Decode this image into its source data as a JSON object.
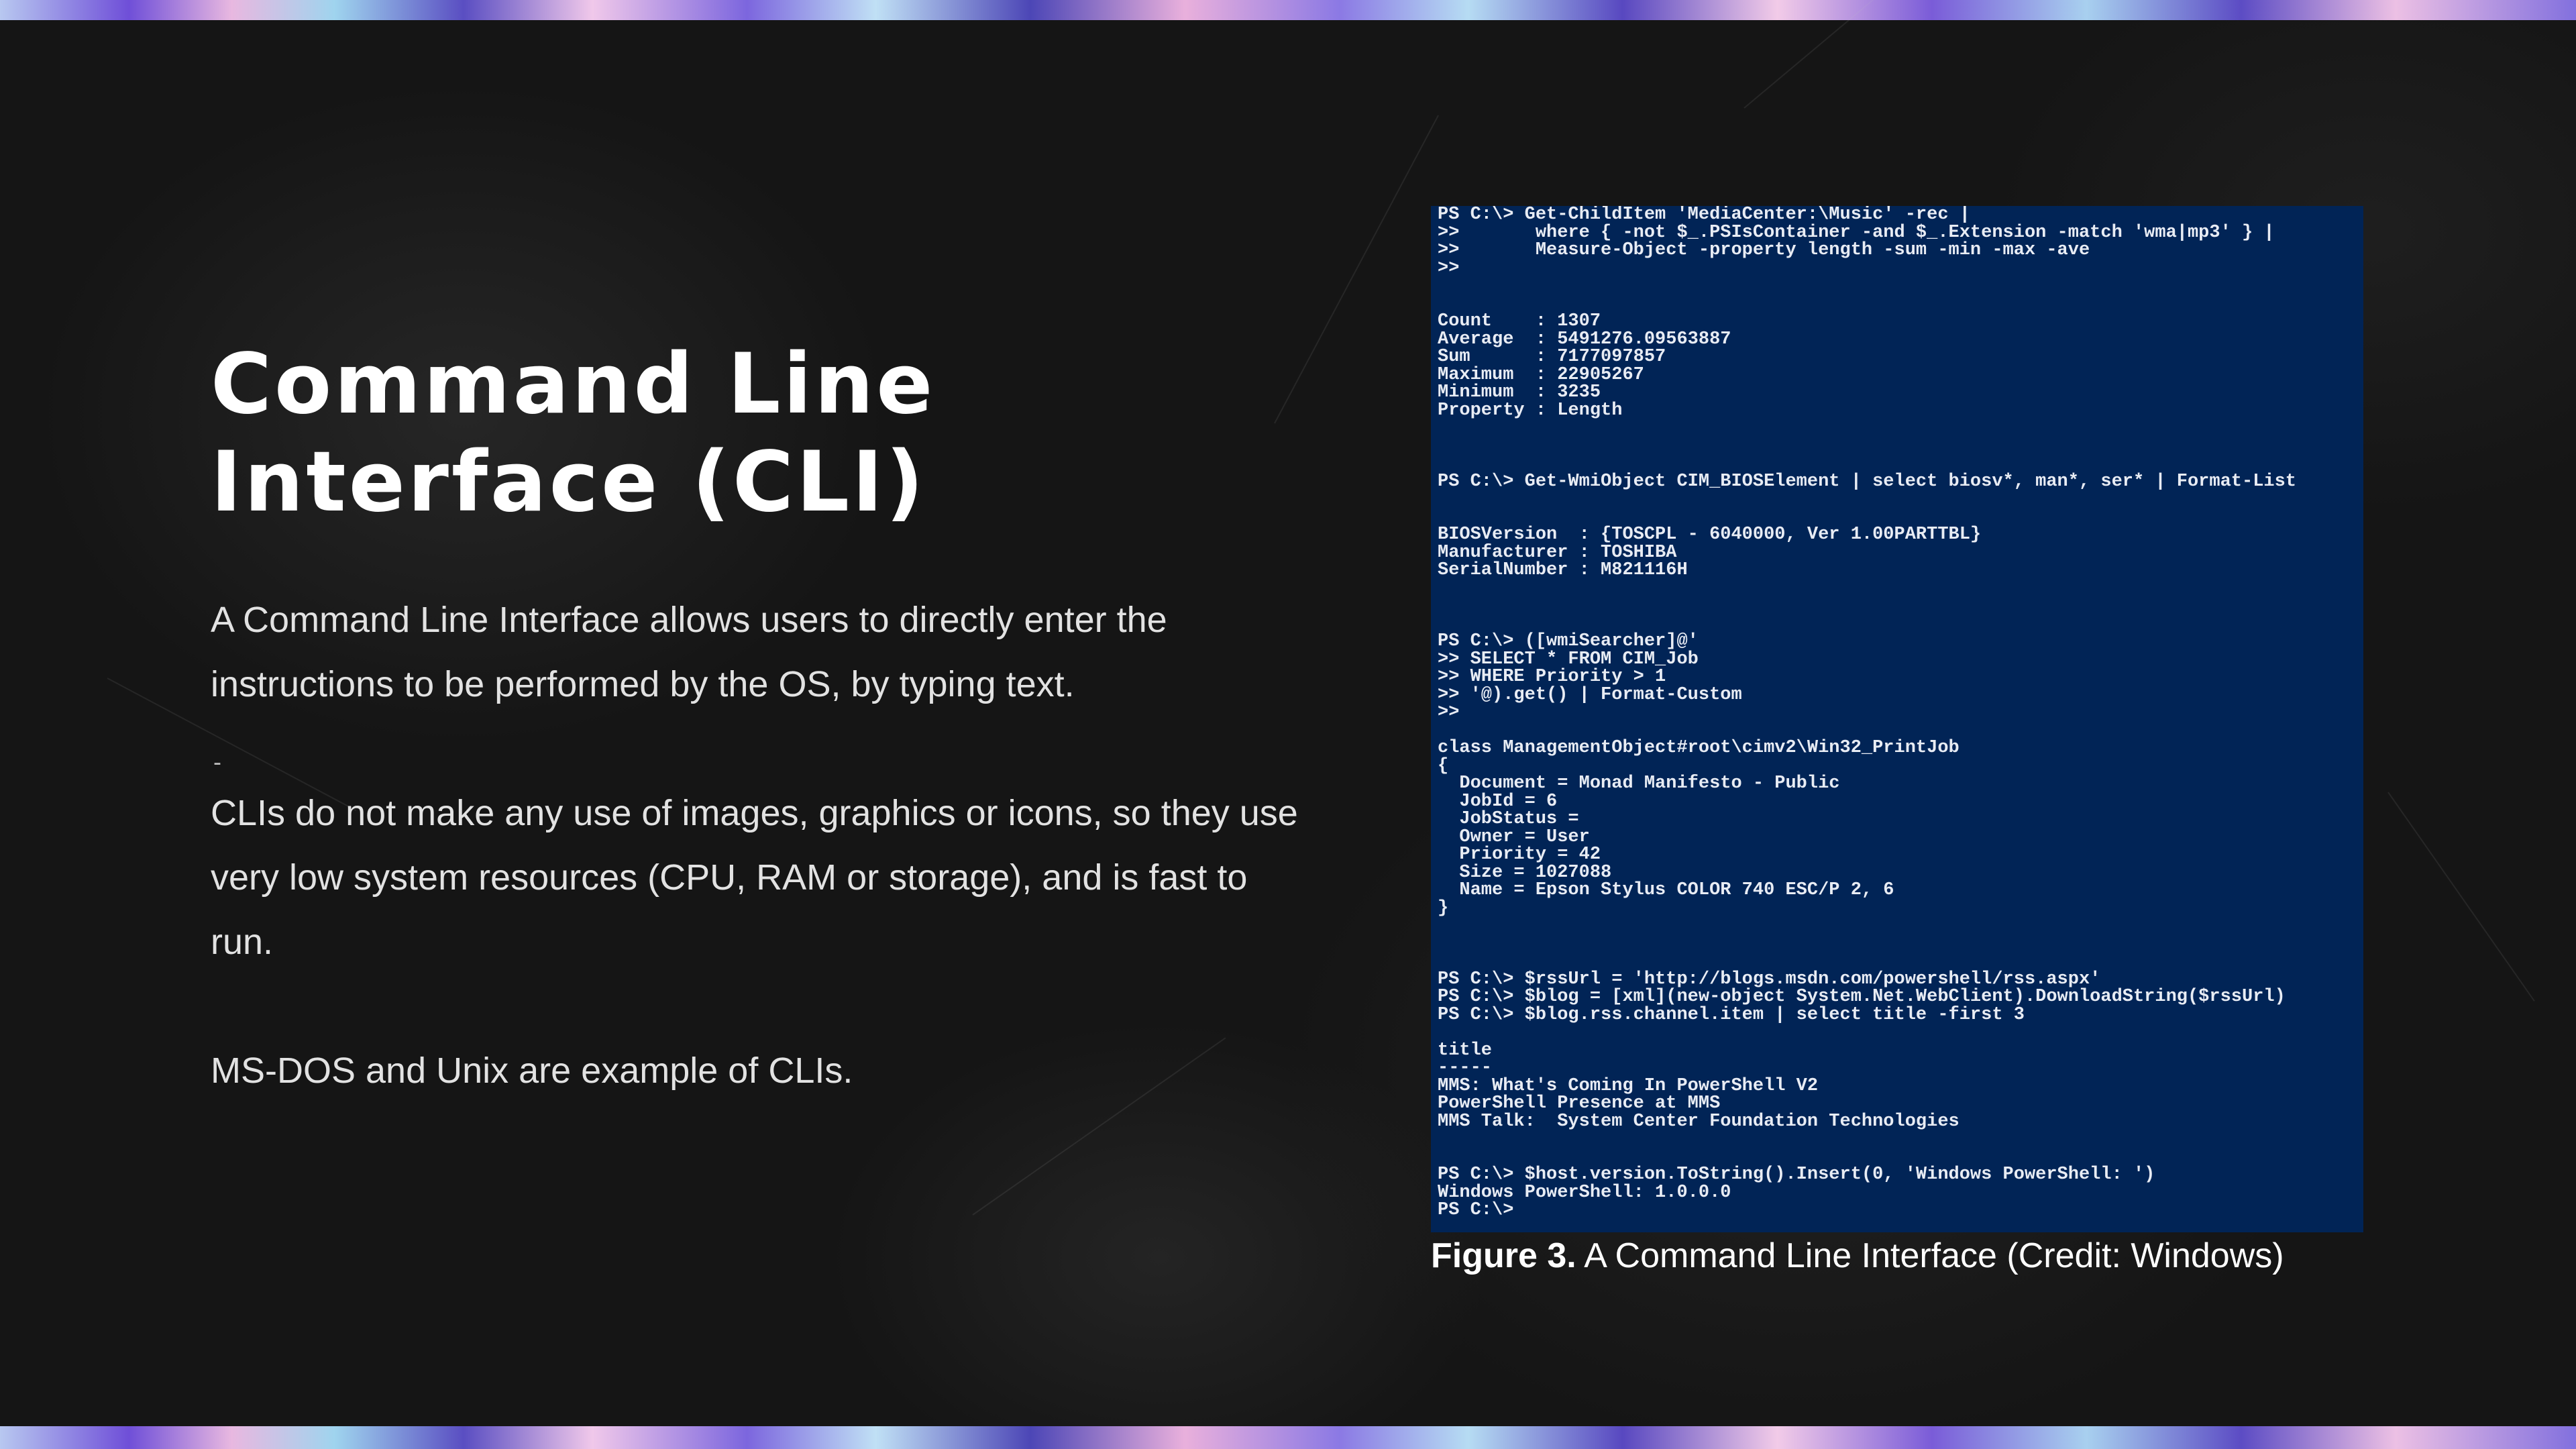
{
  "slide": {
    "title_line1": "Command Line",
    "title_line2": "Interface (CLI)",
    "paragraph1": "A Command Line Interface allows users to directly enter the instructions to be performed by the OS, by typing text.",
    "paragraph2": "CLIs do not make any use of images, graphics or icons, so they use very low system resources (CPU, RAM or storage), and is fast to run.",
    "paragraph3": "MS-DOS and Unix are example of CLIs.",
    "bullet_glyph": "-"
  },
  "terminal": {
    "background_color": "#012456",
    "lines": [
      "PS C:\\> Get-ChildItem 'MediaCenter:\\Music' -rec |",
      ">>       where { -not $_.PSIsContainer -and $_.Extension -match 'wma|mp3' } |",
      ">>       Measure-Object -property length -sum -min -max -ave",
      ">>",
      "",
      "",
      "Count    : 1307",
      "Average  : 5491276.09563887",
      "Sum      : 7177097857",
      "Maximum  : 22905267",
      "Minimum  : 3235",
      "Property : Length",
      "",
      "",
      "",
      "PS C:\\> Get-WmiObject CIM_BIOSElement | select biosv*, man*, ser* | Format-List",
      "",
      "",
      "BIOSVersion  : {TOSCPL - 6040000, Ver 1.00PARTTBL}",
      "Manufacturer : TOSHIBA",
      "SerialNumber : M821116H",
      "",
      "",
      "",
      "PS C:\\> ([wmiSearcher]@'",
      ">> SELECT * FROM CIM_Job",
      ">> WHERE Priority > 1",
      ">> '@).get() | Format-Custom",
      ">>",
      "",
      "class ManagementObject#root\\cimv2\\Win32_PrintJob",
      "{",
      "  Document = Monad Manifesto - Public",
      "  JobId = 6",
      "  JobStatus =",
      "  Owner = User",
      "  Priority = 42",
      "  Size = 1027088",
      "  Name = Epson Stylus COLOR 740 ESC/P 2, 6",
      "}",
      "",
      "",
      "",
      "PS C:\\> $rssUrl = 'http://blogs.msdn.com/powershell/rss.aspx'",
      "PS C:\\> $blog = [xml](new-object System.Net.WebClient).DownloadString($rssUrl)",
      "PS C:\\> $blog.rss.channel.item | select title -first 3",
      "",
      "title",
      "-----",
      "MMS: What's Coming In PowerShell V2",
      "PowerShell Presence at MMS",
      "MMS Talk:  System Center Foundation Technologies",
      "",
      "",
      "PS C:\\> $host.version.ToString().Insert(0, 'Windows PowerShell: ')",
      "Windows PowerShell: 1.0.0.0",
      "PS C:\\>"
    ]
  },
  "caption": {
    "label": "Figure 3.",
    "text": " A Command Line Interface (Credit: Windows)"
  }
}
